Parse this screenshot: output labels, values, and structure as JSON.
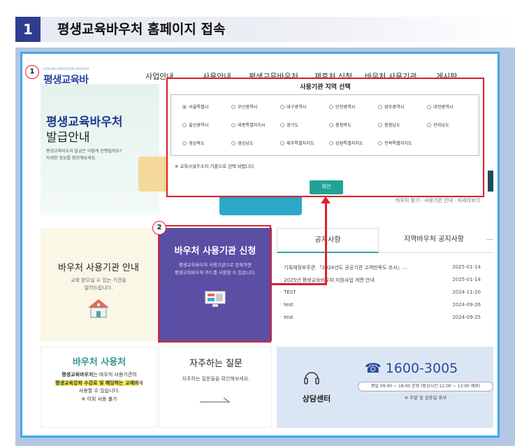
{
  "step": {
    "number": "1",
    "title": "평생교육바우처 홈페이지 접속"
  },
  "site": {
    "logo": "평생교육바우처",
    "logo_sub": "LIFELONG EDUCATION VOUCHER",
    "nav": [
      "사업안내",
      "사용안내",
      "평생교육바우처",
      "제휴처 신청",
      "바우처 사용기관",
      "게시판"
    ]
  },
  "banner": {
    "title": "평생교육바우처",
    "subtitle": "발급안내",
    "desc1": "평생교육바우처 발급은 어떻게 진행될까요?",
    "desc2": "자세한 정보를 확인해보세요."
  },
  "right_text": "바우처 찾기 · 사용기관 안내 · 자세히보기",
  "modal": {
    "title": "사용기관 지역 선택",
    "regions": [
      [
        "서울특별시",
        "부산광역시",
        "대구광역시",
        "인천광역시",
        "광주광역시",
        "대전광역시"
      ],
      [
        "울산광역시",
        "세종특별자치시",
        "경기도",
        "충청북도",
        "충청남도",
        "전라남도"
      ],
      [
        "경상북도",
        "경상남도",
        "제주특별자치도",
        "강원특별자치도",
        "전북특별자치도"
      ]
    ],
    "note": "※ 교육시설주소지 기준으로 선택 바랍니다",
    "ok": "확인"
  },
  "card_guide": {
    "title": "바우처 사용기관 안내",
    "desc1": "교육 받으실 수 있는 기관을",
    "desc2": "알려드립니다."
  },
  "card_apply": {
    "title": "바우처 사용기관 신청",
    "desc1": "평생교육바우처 사용기관으로 등록하면",
    "desc2": "평생교육바우처 카드를 사용할 수 있습니다."
  },
  "notice": {
    "tabs": [
      "공지사항",
      "지역바우처 공지사항"
    ],
    "more": "—",
    "items": [
      {
        "title": "기획재정부주관 「2024년도 공공기관 고객만족도 조사」…",
        "date": "2025-01-14"
      },
      {
        "title": "2025년 평생교육바우처 지원사업 개편 안내",
        "date": "2025-01-14"
      },
      {
        "title": "TEST",
        "date": "2024-11-20"
      },
      {
        "title": "test",
        "date": "2024-09-26"
      },
      {
        "title": "test",
        "date": "2024-09-25"
      }
    ]
  },
  "card_use": {
    "title": "바우처 사용처",
    "line1_a": "평생교육바우처",
    "line1_b": "는 바우처 사용기관의",
    "line2": "평생교육강좌 수강료 및 해당하는 교재비",
    "line2_b": "에",
    "line3": "사용할 수 있습니다.",
    "line4": "※ 이외 사용 불가"
  },
  "card_faq": {
    "title": "자주하는 질문",
    "desc": "자주하는 질문들을 확인해보세요."
  },
  "center": {
    "label": "상담센터",
    "phone": "☎ 1600-3005",
    "hours": "평일 09:00 ~ 18:00 운영 (점심시간 12:00 ~ 13:00 제외)",
    "holiday": "※ 주말 및 공휴일 휴무"
  },
  "callouts": [
    "1",
    "2"
  ]
}
